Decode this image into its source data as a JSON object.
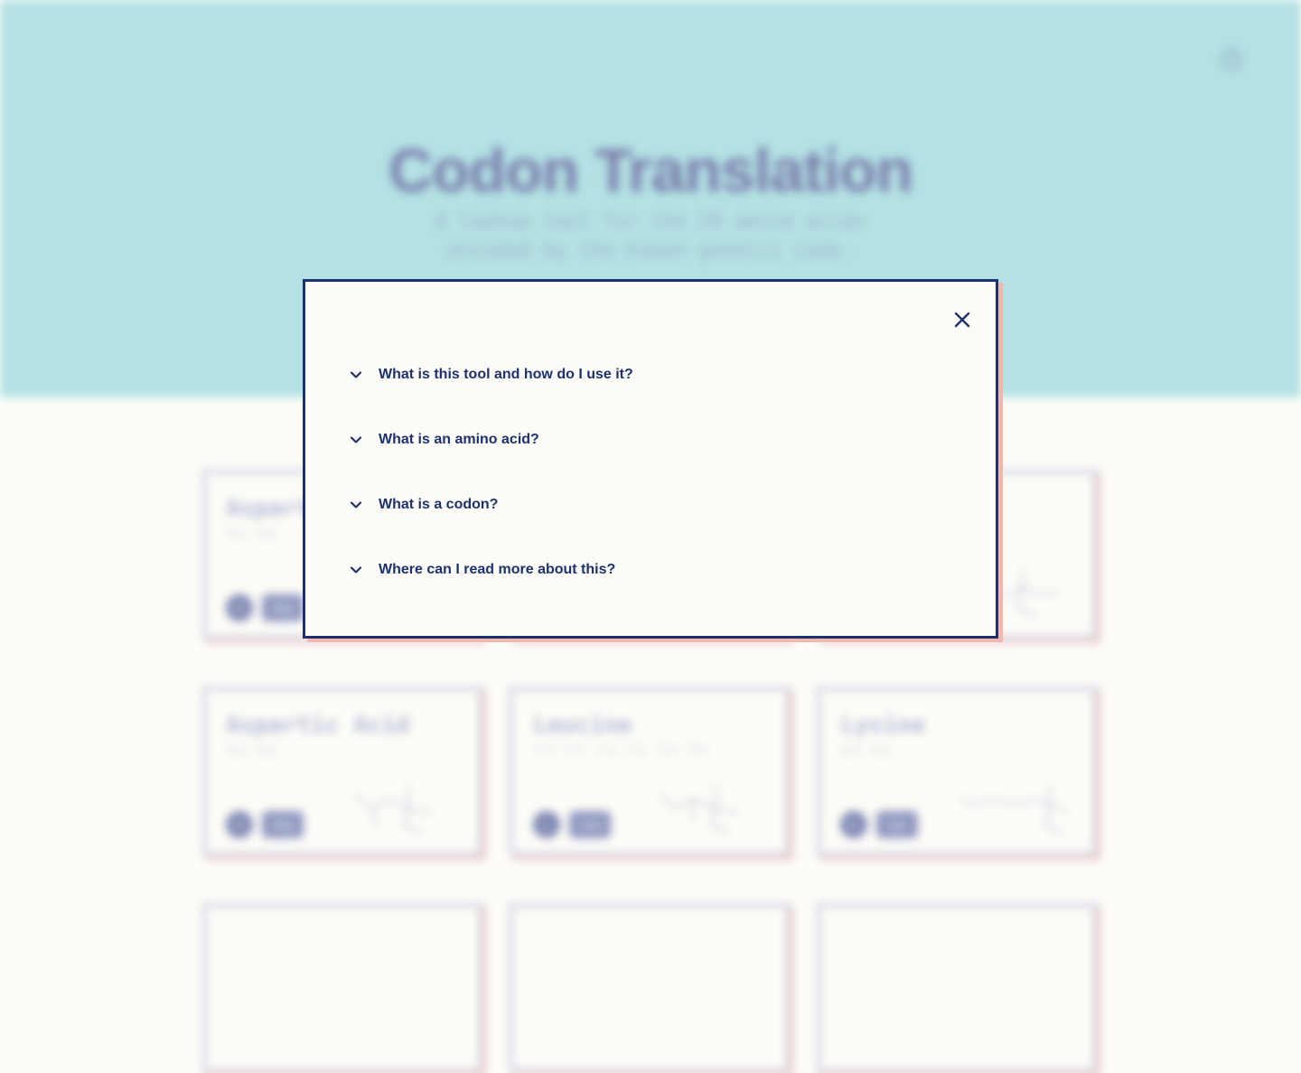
{
  "app": {
    "title": "Codon Translation",
    "subtitle_line1": "A lookup tool for the 20 amino acids",
    "subtitle_line2": "encoded by the human genetic code.",
    "help_label": "?"
  },
  "colors": {
    "hero_bg": "#b3e1e4",
    "page_bg": "#fdfcf8",
    "navy": "#1d3170",
    "shadow_salmon": "#f2b8ac"
  },
  "cards": [
    {
      "name": "Aspartic Acid",
      "codons": "GAT GAC",
      "letter": "D",
      "abbr": "Asp"
    },
    {
      "name": "Leucine",
      "codons": "CTT CTC CTA CTG TTA TTG",
      "letter": "L",
      "abbr": "Leu"
    },
    {
      "name": "Lysine",
      "codons": "AAT AAC",
      "letter": "K",
      "abbr": "Lys"
    }
  ],
  "modal": {
    "close_icon": "close-icon",
    "faq": [
      {
        "question": "What is this tool and how do I use it?"
      },
      {
        "question": "What is an amino acid?"
      },
      {
        "question": "What is a codon?"
      },
      {
        "question": "Where can I read more about this?"
      }
    ]
  }
}
